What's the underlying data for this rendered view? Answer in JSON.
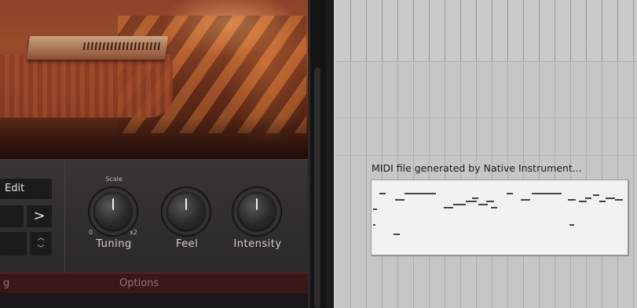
{
  "plugin": {
    "edit_label": "Edit",
    "next_label": ">",
    "stepper_label": "▲▼",
    "knobs": [
      {
        "label": "Tuning",
        "top_caption": "Scale",
        "min_caption": "0",
        "max_caption": "x2"
      },
      {
        "label": "Feel"
      },
      {
        "label": "Intensity"
      }
    ],
    "tabs": [
      {
        "label": "g"
      },
      {
        "label": "Options"
      }
    ]
  },
  "arrangement": {
    "clip_title": "MIDI file generated by Native Instrument..."
  },
  "colors": {
    "plugin_bg": "#2a2727",
    "tab_bar": "#3b1616",
    "arrangement_bg": "#c6c6c6",
    "clip_bg": "#f2f2f2"
  }
}
